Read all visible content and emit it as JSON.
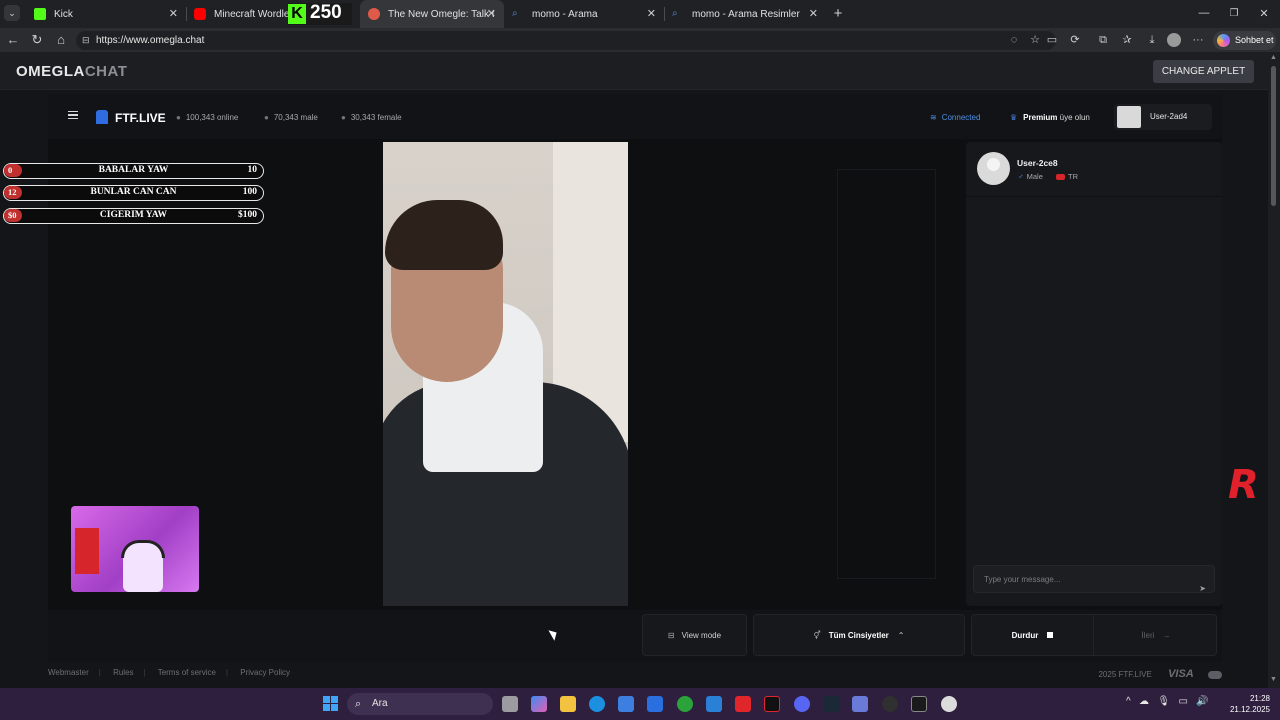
{
  "browser": {
    "tabs": [
      {
        "title": "Kick",
        "color": "#53fc18"
      },
      {
        "title": "Minecraft Wordle Oyun",
        "color": "#ff0000"
      },
      {
        "title": "The New Omegle: Talk to Stra",
        "color": "#e05a4a"
      },
      {
        "title": "momo - Arama",
        "color": "#4f8fe6"
      },
      {
        "title": "momo - Arama Resimler",
        "color": "#4f8fe6"
      }
    ],
    "url": "https://www.omegla.chat",
    "copilot_label": "Sohbet et",
    "kick_count": "250"
  },
  "omegla": {
    "logo_a": "OMEGLA",
    "logo_b": "CHAT",
    "change_applet": "CHANGE APPLET"
  },
  "ftf": {
    "logo": "FTF.LIVE",
    "online": "100,343 online",
    "male": "70,343 male",
    "female": "30,343 female",
    "connected": "Connected",
    "premium_bold": "Premium",
    "premium_rest": " üye olun",
    "username": "User-2ad4"
  },
  "scoreboard": [
    {
      "badge": "0",
      "label": "BABALAR YAW",
      "value": "10"
    },
    {
      "badge": "12",
      "label": "BUNLAR CAN CAN",
      "value": "100"
    },
    {
      "badge": "$0",
      "label": "CIGERIM YAW",
      "value": "$100"
    }
  ],
  "peer": {
    "name": "User-2ce8",
    "gender": "Male",
    "country": "TR"
  },
  "chat": {
    "placeholder": "Type your message..."
  },
  "controls": {
    "view_mode": "View mode",
    "gender_filter": "Tüm Cinsiyetler",
    "stop": "Durdur",
    "next": "İleri"
  },
  "footer": {
    "links": [
      "Webmaster",
      "Rules",
      "Terms of service",
      "Privacy Policy"
    ],
    "copyright": "2025 FTF.LIVE",
    "visa": "VISA"
  },
  "taskbar": {
    "search": "Ara",
    "time": "21:28",
    "date": "21.12.2025"
  }
}
